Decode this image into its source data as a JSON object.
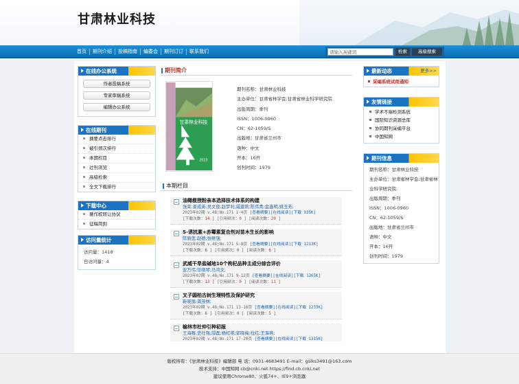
{
  "site": {
    "title": "甘肃林业科技"
  },
  "nav": {
    "items": [
      "首页",
      "期刊介绍",
      "投稿指南",
      "编委会",
      "期刊订订",
      "联系我们"
    ],
    "search_placeholder": "请输入关键词",
    "search_btn": "检索",
    "adv_btn": "高级搜索"
  },
  "left": {
    "office": {
      "title": "在线办公系统",
      "items": [
        "作者投稿系统",
        "专家审稿系统",
        "编辑办公系统"
      ]
    },
    "journal": {
      "title": "在线期刊",
      "items": [
        "摘要点击排行",
        "被引频次排行",
        "本期栏目",
        "过刊浏览",
        "高级检索",
        "全文下载排行"
      ]
    },
    "download": {
      "title": "下载中心",
      "items": [
        "著作权转让协议",
        "征稿简则"
      ]
    },
    "stats": {
      "title": "访问量统计",
      "visits": "访问量：1418",
      "today": "日访问量：4"
    }
  },
  "intro": {
    "title": "期刊简介",
    "cover_title": "甘肃林业科技",
    "cover_year": "2023",
    "fields": [
      "期刊名称：甘肃林业科技",
      "主办单位：甘肃省林学会;甘肃省林业科学研究院",
      "出版周期：季刊",
      "ISSN：1006-0960",
      "CN：62-1059/S",
      "出版地：甘肃省兰州市",
      "语种：中文",
      "开本：16开",
      "创刊时间：1979"
    ]
  },
  "current": {
    "title": "本期栏目",
    "articles": [
      {
        "title": "油橄榄授粉亲本选择技术体系的构建",
        "authors": "张荣;姜成英;吴文俊;赵梦利;戚建莉;陈伟青;金鑫明;姚玉芳;",
        "meta1": "2023年02期 v.48;No.171 1-4页",
        "links1": "[查看摘要][在线阅读][下载 935K]",
        "meta2a": "[下载次数：",
        "n1": "14",
        "meta2b": " ] [引用频次：",
        "n2": "0",
        "meta2c": " ] [阅读次数：",
        "n3": "20",
        "meta2d": " ]"
      },
      {
        "title": "S-诱抗素+赤霉素复合剂对苗木生长的影响",
        "authors": "陈丽莲;赵德;张继强;",
        "meta1": "2023年02期 v.48;No.171 5-8页",
        "links1": "[查看摘要][在线阅读][下载 1213K]",
        "meta2a": "[下载次数：",
        "n1": "6",
        "meta2b": " ] [引用频次：",
        "n2": "0",
        "meta2c": " ] [阅读次数：",
        "n3": "6",
        "meta2d": " ]"
      },
      {
        "title": "武威干旱盐碱地10个枸杞品种主成分综合评价",
        "authors": "安万伟;华晓琴;马鸿文;",
        "meta1": "2023年02期 v.48;No.171 9-12页",
        "links1": "[查看摘要][在线阅读][下载 1265K]",
        "meta2a": "[下载次数：",
        "n1": "13",
        "meta2b": " ] [引用频次：",
        "n2": "0",
        "meta2c": " ] [阅读次数：",
        "n3": "11",
        "meta2d": " ]"
      },
      {
        "title": "叉子圆柏古树生理特性及保护研究",
        "authors": "靳晓丽;龚茂林;",
        "meta1": "2023年02期 v.48;No.171 13-16页",
        "links1": "[查看摘要][在线阅读][下载 1233K]",
        "meta2a": "[下载次数：",
        "n1": "6",
        "meta2b": " ] [引用频次：",
        "n2": "0",
        "meta2c": " ] [阅读次数：",
        "n3": "5",
        "meta2d": " ]"
      },
      {
        "title": "榆林市杜仲引种初报",
        "authors": "王海骞;史社强;郜磊;杨红艳;郭晓梅;拉红;王海燕;",
        "meta1": "2023年02期 v.48;No.171 17-20页",
        "links1": "[查看摘要][在线阅读][下载 1315K]",
        "meta2a": "[下载次数：",
        "n1": "6",
        "meta2b": " ] [引用频次：",
        "n2": "0",
        "meta2c": " ] [阅读次数：",
        "n3": "4",
        "meta2d": " ]"
      }
    ]
  },
  "right": {
    "news": {
      "title": "最新动态",
      "more": "更多>>",
      "items": [
        "采编系统试用通知"
      ]
    },
    "links": {
      "title": "友情链接",
      "items": [
        "学术不端检测系统",
        "国际知识资源总库",
        "协同期刊采编平台",
        "中国知网"
      ]
    },
    "info": {
      "title": "期刊信息",
      "fields": [
        "期刊名称：甘肃林业科技",
        "主办单位：甘肃省林学会;甘肃省林业科学研究院",
        "出版周期：季刊",
        "ISSN：1006-0960",
        "CN：62-1059/S",
        "出版地：甘肃省兰州市",
        "语种：中文",
        "开本：16开",
        "创刊时间：1979"
      ]
    }
  },
  "footer": {
    "line1": "版权所有：《甘肃林业科技》编辑部   电 话：0931-4683491  E-mail：gslks3491@163.com",
    "line2": "技术支持：中国知网 cb@cnki.net   https://find.cb.cnki.net",
    "line3": "建议使用Chrome80、火狐74+、IE9+浏览器"
  }
}
